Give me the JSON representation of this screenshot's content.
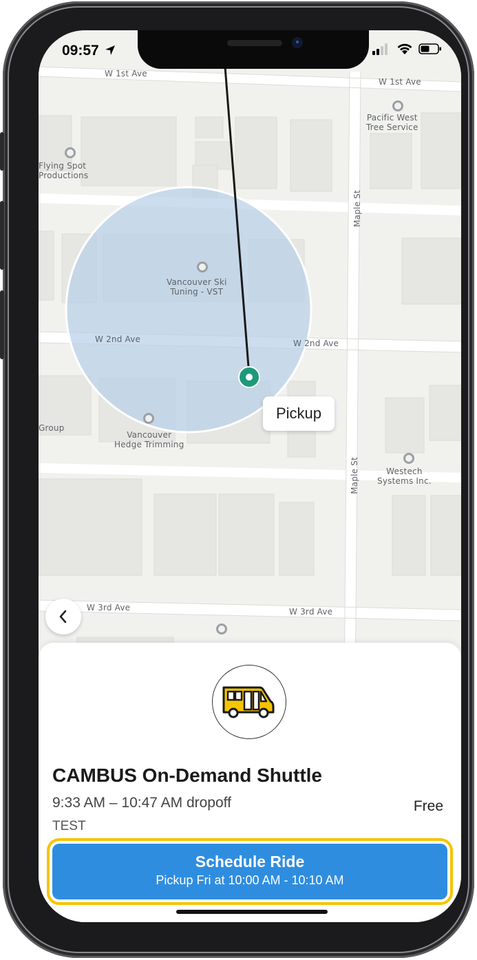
{
  "status_bar": {
    "time": "09:57"
  },
  "map": {
    "street_labels": [
      "W 1st Ave",
      "W 1st Ave",
      "W 2nd Ave",
      "W 2nd Ave",
      "W 3rd Ave",
      "W 3rd Ave",
      "Maple St",
      "Maple St"
    ],
    "poi_labels": [
      "Pacific West\nTree Service",
      "Flying Spot\nProductions",
      "Vancouver Ski\nTuning - VST",
      "Vancouver\nHedge Trimming",
      "Group",
      "Westech\nSystems Inc."
    ],
    "pickup_label": "Pickup",
    "colors": {
      "radius_fill": "#b7cfe8",
      "pickup_marker": "#1e9a78",
      "route_line": "#1a1a1a"
    }
  },
  "ride_sheet": {
    "service_name": "CAMBUS On-Demand Shuttle",
    "time_range": "9:33 AM – 10:47 AM dropoff",
    "subtitle": "TEST",
    "fare": "Free",
    "cta": {
      "title": "Schedule Ride",
      "subtitle": "Pickup Fri at 10:00 AM - 10:10 AM"
    },
    "colors": {
      "cta": "#2f8de0",
      "highlight": "#f5c400",
      "bus": "#f5c400"
    }
  }
}
